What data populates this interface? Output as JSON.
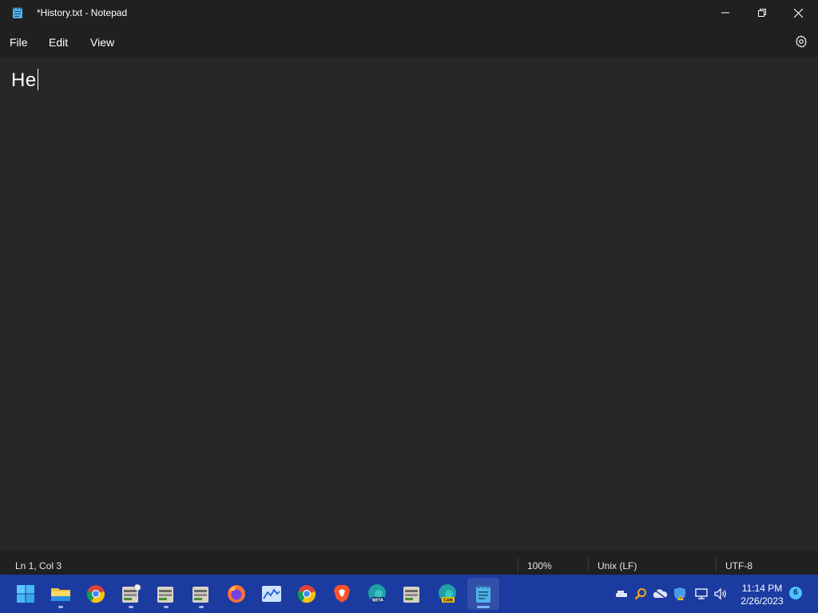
{
  "window": {
    "title": "*History.txt - Notepad",
    "app_icon": "notepad-icon"
  },
  "window_controls": {
    "minimize_icon": "minimize-icon",
    "maximize_icon": "restore-icon",
    "close_icon": "close-icon"
  },
  "menu": {
    "items": [
      {
        "label": "File"
      },
      {
        "label": "Edit"
      },
      {
        "label": "View"
      }
    ],
    "settings_icon": "gear-icon"
  },
  "editor": {
    "text": "He"
  },
  "status": {
    "position": "Ln 1, Col 3",
    "zoom": "100%",
    "line_ending": "Unix (LF)",
    "encoding": "UTF-8"
  },
  "taskbar": {
    "apps": [
      {
        "name": "windows-start-icon",
        "running": false
      },
      {
        "name": "file-explorer-icon",
        "running": true
      },
      {
        "name": "chrome-icon",
        "running": false
      },
      {
        "name": "app-bulb-icon",
        "running": true
      },
      {
        "name": "app-bulb-icon",
        "running": true
      },
      {
        "name": "app-bulb-icon",
        "running": true
      },
      {
        "name": "firefox-icon",
        "running": false
      },
      {
        "name": "chart-app-icon",
        "running": false
      },
      {
        "name": "chrome-icon",
        "running": false
      },
      {
        "name": "brave-icon",
        "running": false
      },
      {
        "name": "edge-beta-icon",
        "running": false
      },
      {
        "name": "app-bulb-icon",
        "running": false
      },
      {
        "name": "edge-canary-icon",
        "running": false
      },
      {
        "name": "notepad-icon",
        "running": true
      }
    ],
    "tray_icons": [
      "usb-drive-icon",
      "search-tray-icon",
      "onedrive-icon",
      "windows-security-icon",
      "network-icon",
      "volume-icon"
    ],
    "time": "11:14 PM",
    "date": "2/26/2023",
    "notification_count": "6"
  },
  "colors": {
    "title_bar": "#202020",
    "editor_bg": "#272727",
    "taskbar": "#1b3ba0",
    "accent": "#4cc2ff"
  }
}
